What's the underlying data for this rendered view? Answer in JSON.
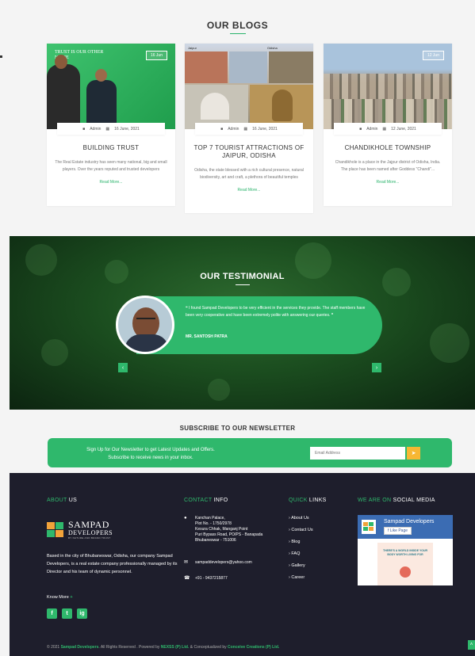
{
  "blogs": {
    "title": "OUR BLOGS",
    "cards": [
      {
        "tag": "16 Jun",
        "img_caption": "TRUST IS OUR OTHER NAME",
        "author": "Admin",
        "date": "16 June, 2021",
        "title": "BUILDING TRUST",
        "text": "The Real Estate industry has seen many national, big and small players. Over the years reputed and trusted developers",
        "more": "Read More..."
      },
      {
        "tag": "",
        "img_caption_left": "Jaipur",
        "img_caption_right": "Odisha",
        "author": "Admin",
        "date": "16 June, 2021",
        "title": "TOP 7 TOURIST ATTRACTIONS OF JAIPUR, ODISHA",
        "text": "Odisha, the state blessed with a rich cultural presence, natural biodiversity, art and craft, a plethora of beautiful temples",
        "more": "Read More..."
      },
      {
        "tag": "12 Jun",
        "author": "Admin",
        "date": "12 June, 2021",
        "title": "CHANDIKHOLE TOWNSHIP",
        "text": "Chandikhole is a place in the Jajpur district of Odisha, India. The place has been named after Goddess \"Chandi\"...",
        "more": "Read More..."
      }
    ]
  },
  "testimonial": {
    "title": "OUR TESTIMONIAL",
    "quote": "I found Sampad Developers to be very efficient in the services they provide. The staff members have been very cooperative and have been extremely polite with answering our queries.",
    "name": "MR. SANTOSH PATRA",
    "prev_icon": "chevron-left-icon",
    "next_icon": "chevron-right-icon"
  },
  "newsletter": {
    "title": "SUBSCRIBE TO OUR NEWSLETTER",
    "line1": "Sign Up for Our Newsletter to get Latest Updates and Offers.",
    "line2": "Subscribe to receive news in your inbox.",
    "placeholder": "Email Address",
    "button_icon": "send-icon"
  },
  "footer": {
    "about": {
      "title_hl": "ABOUT",
      "title_rest": " US"
    },
    "logo": {
      "name": "SAMPAD",
      "sub": "DEVELOPERS",
      "tag": "BY NATURE AND BRAND TRUST"
    },
    "about_text": "Based in the city of Bhubaneswar, Odisha, our company Sampad Developers, is a real estate company professionally managed by its Director and his team of dynamic personnel.",
    "know_more": "Know More",
    "social": [
      "f",
      "t",
      "ig"
    ],
    "contact": {
      "title_hl": "CONTACT",
      "title_rest": " INFO",
      "address": [
        "Kanchan Palace,",
        "Plot No. - 1750/2978",
        "Kesura Chhak, Manganj Point",
        "Puri Bypass Road, PO/PS - Banapada",
        "Bhubaneswar - 751006"
      ],
      "email": "sampaddevelopers@yahoo.com",
      "phone": "+91 - 9437215877"
    },
    "links": {
      "title_hl": "QUICK",
      "title_rest": " LINKS",
      "items": [
        "About Us",
        "Contact Us",
        "Blog",
        "FAQ",
        "Gallery",
        "Career"
      ]
    },
    "social_media": {
      "title_hl": "WE ARE ON",
      "title_rest": " SOCIAL MEDIA",
      "page_name": "Sampad Developers",
      "like_label": "Like Page",
      "ad_text": "THERE'S A WORLD INSIDE YOUR BODY WORTH LIVING FOR"
    },
    "copyright": {
      "prefix": "© 2021 ",
      "brand": "Sampad Developers",
      "mid": ". All Rights Reserved . Powered by ",
      "powered": "NEXSS (P) Ltd.",
      "mid2": " & Conceptualized by ",
      "concept": "Conceive Creations (P) Ltd."
    }
  },
  "colors": {
    "accent": "#2fb86c",
    "footer_bg": "#1e1e2c",
    "cta": "#f7b733"
  }
}
